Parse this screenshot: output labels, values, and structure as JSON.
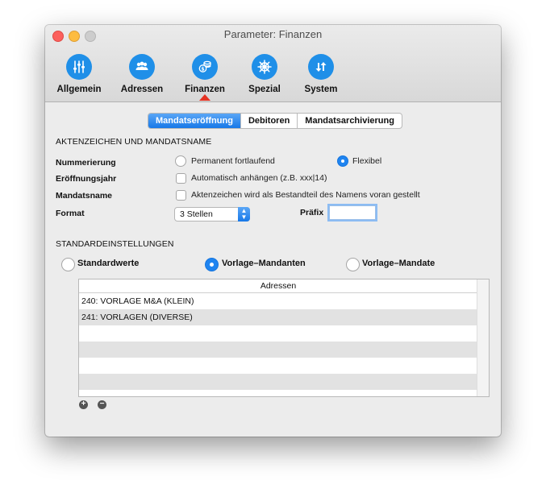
{
  "window": {
    "title": "Parameter: Finanzen"
  },
  "toolbar": {
    "items": [
      {
        "label": "Allgemein",
        "icon": "sliders-icon"
      },
      {
        "label": "Adressen",
        "icon": "people-icon"
      },
      {
        "label": "Finanzen",
        "icon": "coins-icon",
        "selected": true
      },
      {
        "label": "Spezial",
        "icon": "helm-icon"
      },
      {
        "label": "System",
        "icon": "arrows-icon"
      }
    ]
  },
  "tabs": [
    {
      "label": "Mandatseröffnung",
      "active": true
    },
    {
      "label": "Debitoren",
      "active": false
    },
    {
      "label": "Mandatsarchivierung",
      "active": false
    }
  ],
  "aktenzeichen": {
    "heading": "AKTENZEICHEN UND MANDATSNAME",
    "nummerierung_label": "Nummerierung",
    "nummerierung_options": [
      {
        "label": "Permanent fortlaufend",
        "selected": false
      },
      {
        "label": "Flexibel",
        "selected": true
      }
    ],
    "eroeffnungsjahr_label": "Eröffnungsjahr",
    "eroeffnungsjahr_checkbox": {
      "label": "Automatisch anhängen (z.B. xxx|14)",
      "checked": false
    },
    "mandatsname_label": "Mandatsname",
    "mandatsname_checkbox": {
      "label": "Aktenzeichen wird als Bestandteil des Namens voran gestellt",
      "checked": false
    },
    "format_label": "Format",
    "format_value": "3 Stellen",
    "praefix_label": "Präfix",
    "praefix_value": ""
  },
  "standard": {
    "heading": "STANDARDEINSTELLUNGEN",
    "options": [
      {
        "label": "Standardwerte",
        "selected": false
      },
      {
        "label": "Vorlage–Mandanten",
        "selected": true
      },
      {
        "label": "Vorlage–Mandate",
        "selected": false
      }
    ],
    "table": {
      "header": "Adressen",
      "rows": [
        "240: VORLAGE M&A (KLEIN)",
        "241: VORLAGEN (DIVERSE)"
      ]
    }
  },
  "colors": {
    "accent": "#1f8fe8",
    "pointer": "#e63323"
  }
}
